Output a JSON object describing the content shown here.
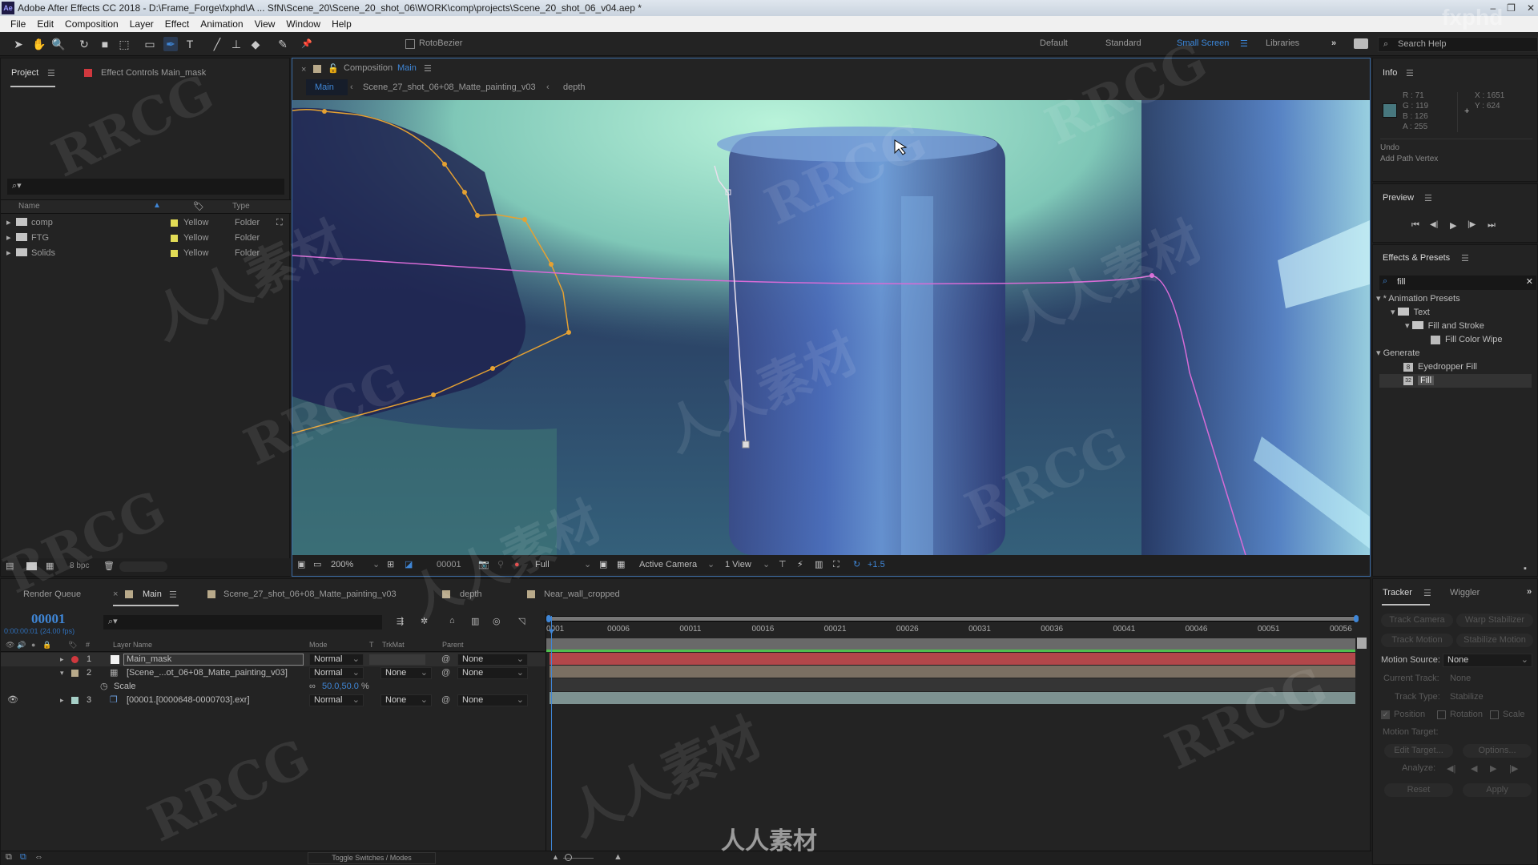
{
  "app": {
    "title": "Adobe After Effects CC 2018 - D:\\Frame_Forge\\fxphd\\A ... SfN\\Scene_20\\Scene_20_shot_06\\WORK\\comp\\projects\\Scene_20_shot_06_v04.aep *",
    "icon_label": "Ae",
    "window_controls": [
      "–",
      "❐",
      "✕"
    ]
  },
  "menu": [
    "File",
    "Edit",
    "Composition",
    "Layer",
    "Effect",
    "Animation",
    "View",
    "Window",
    "Help"
  ],
  "toolbar": {
    "tools": [
      {
        "name": "selection-tool-icon",
        "glyph": "➤"
      },
      {
        "name": "hand-tool-icon",
        "glyph": "✋"
      },
      {
        "name": "zoom-tool-icon",
        "glyph": "🔍"
      },
      {
        "name": "rotate-tool-icon",
        "glyph": "↻"
      },
      {
        "name": "camera-tool-icon",
        "glyph": "■"
      },
      {
        "name": "pan-behind-tool-icon",
        "glyph": "⬚"
      },
      {
        "name": "rectangle-tool-icon",
        "glyph": "▭"
      },
      {
        "name": "pen-tool-icon",
        "glyph": "✒",
        "active": true
      },
      {
        "name": "type-tool-icon",
        "glyph": "T"
      },
      {
        "name": "brush-tool-icon",
        "glyph": "╱"
      },
      {
        "name": "clone-stamp-tool-icon",
        "glyph": "⊥"
      },
      {
        "name": "eraser-tool-icon",
        "glyph": "◆"
      },
      {
        "name": "roto-brush-tool-icon",
        "glyph": "✎"
      },
      {
        "name": "puppet-pin-tool-icon",
        "glyph": "📌"
      }
    ],
    "rotobezier_label": "RotoBezier",
    "rotobezier_checked": false,
    "workspaces": [
      {
        "label": "Default",
        "active": false
      },
      {
        "label": "Standard",
        "active": false
      },
      {
        "label": "Small Screen",
        "active": true
      },
      {
        "label": "Libraries",
        "active": false
      }
    ],
    "overflow": "»",
    "search_help_placeholder": "Search Help"
  },
  "project_panel": {
    "tabs": [
      {
        "label": "Project",
        "active": true
      },
      {
        "label": "Effect Controls Main_mask",
        "active": false,
        "swatch": "#d0383e"
      }
    ],
    "search_placeholder": "",
    "columns": [
      "Name",
      "",
      "Type"
    ],
    "items": [
      {
        "name": "comp",
        "label": "Yellow",
        "type": "Folder",
        "color": "#e2dc56"
      },
      {
        "name": "FTG",
        "label": "Yellow",
        "type": "Folder",
        "color": "#e2dc56"
      },
      {
        "name": "Solids",
        "label": "Yellow",
        "type": "Folder",
        "color": "#e2dc56"
      }
    ],
    "bpc": "8 bpc"
  },
  "composition_panel": {
    "tab_prefix": "Composition",
    "tab_name": "Main",
    "breadcrumbs": [
      "Main",
      "Scene_27_shot_06+08_Matte_painting_v03",
      "depth"
    ],
    "footer": {
      "zoom": "200%",
      "frame": "00001",
      "resolution": "Full",
      "camera": "Active Camera",
      "views": "1 View",
      "exposure": "+1.5"
    }
  },
  "info_panel": {
    "title": "Info",
    "color": {
      "r": "71",
      "g": "119",
      "b": "126",
      "a": "255",
      "swatch": "#47777e"
    },
    "position": {
      "x": "1651",
      "y": "624"
    },
    "r_label": "R :",
    "g_label": "G :",
    "b_label": "B :",
    "a_label": "A :",
    "x_label": "X :",
    "y_label": "Y :",
    "undo_title": "Undo",
    "undo_action": "Add Path Vertex"
  },
  "preview_panel": {
    "title": "Preview",
    "controls": [
      "⏮",
      "◀|",
      "▶",
      "|▶",
      "⏭"
    ]
  },
  "effects_panel": {
    "title": "Effects & Presets",
    "search_value": "fill",
    "tree": [
      {
        "label": "* Animation Presets",
        "level": 0,
        "kind": "group"
      },
      {
        "label": "Text",
        "level": 1,
        "kind": "folder"
      },
      {
        "label": "Fill and Stroke",
        "level": 2,
        "kind": "folder"
      },
      {
        "label": "Fill Color Wipe",
        "level": 3,
        "kind": "preset"
      },
      {
        "label": "Generate",
        "level": 0,
        "kind": "group"
      },
      {
        "label": "Eyedropper Fill",
        "level": 1,
        "kind": "effect",
        "badge": "8"
      },
      {
        "label": "Fill",
        "level": 1,
        "kind": "effect",
        "badge": "32",
        "selected": true
      }
    ]
  },
  "timeline": {
    "tabs": [
      {
        "label": "Render Queue",
        "active": false
      },
      {
        "label": "Main",
        "active": true,
        "swatch": "#b8a98a"
      },
      {
        "label": "Scene_27_shot_06+08_Matte_painting_v03",
        "active": false,
        "swatch": "#b8a98a"
      },
      {
        "label": "depth",
        "active": false,
        "swatch": "#b8a98a"
      },
      {
        "label": "Near_wall_cropped",
        "active": false,
        "swatch": "#b8a98a"
      }
    ],
    "current_frame": "00001",
    "timecode": "0:00:00:01 (24.00 fps)",
    "columns": {
      "layer_name": "Layer Name",
      "mode": "Mode",
      "t": "T",
      "trkmat": "TrkMat",
      "parent": "Parent",
      "num": "#"
    },
    "layers": [
      {
        "num": "1",
        "name": "Main_mask",
        "mode": "Normal",
        "trkmat": "",
        "parent": "None",
        "label_color": "#d0383e",
        "bar_color": "#b2474a",
        "expanded": false,
        "selected": true
      },
      {
        "num": "2",
        "name": "[Scene_...ot_06+08_Matte_painting_v03]",
        "mode": "Normal",
        "trkmat": "None",
        "parent": "None",
        "label_color": "#b8a98a",
        "bar_color": "#7a6f62",
        "expanded": true
      },
      {
        "num": "3",
        "name": "[00001.[0000648-0000703].exr]",
        "mode": "Normal",
        "trkmat": "None",
        "parent": "None",
        "label_color": "#a6cfc7",
        "bar_color": "#7d9291",
        "expanded": false
      }
    ],
    "property": {
      "name": "Scale",
      "value": "50.0,50.0",
      "unit": "%"
    },
    "ruler_ticks": [
      "0001",
      "00006",
      "00011",
      "00016",
      "00021",
      "00026",
      "00031",
      "00036",
      "00041",
      "00046",
      "00051",
      "00056"
    ],
    "toggle_label": "Toggle Switches / Modes"
  },
  "tracker_panel": {
    "tabs": [
      {
        "label": "Tracker",
        "active": true
      },
      {
        "label": "Wiggler",
        "active": false
      }
    ],
    "buttons_row1": [
      "Track Camera",
      "Warp Stabilizer"
    ],
    "buttons_row2": [
      "Track Motion",
      "Stabilize Motion"
    ],
    "motion_source_label": "Motion Source:",
    "motion_source_value": "None",
    "current_track_label": "Current Track:",
    "current_track_value": "None",
    "track_type_label": "Track Type:",
    "track_type_value": "Stabilize",
    "checks": [
      {
        "label": "Position",
        "checked": true
      },
      {
        "label": "Rotation",
        "checked": false
      },
      {
        "label": "Scale",
        "checked": false
      }
    ],
    "motion_target_label": "Motion Target:",
    "edit_target_label": "Edit Target...",
    "options_label": "Options...",
    "analyze_label": "Analyze:",
    "reset_label": "Reset",
    "apply_label": "Apply"
  },
  "watermarks": [
    "RRCG",
    "人人素材",
    "fxphd"
  ]
}
